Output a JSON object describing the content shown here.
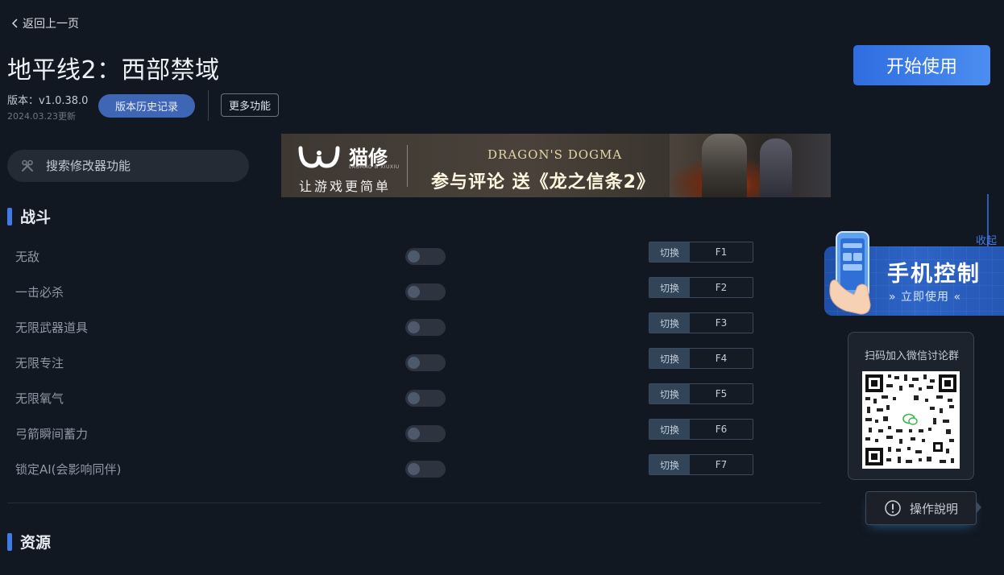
{
  "nav": {
    "back_label": "返回上一页"
  },
  "header": {
    "title": "地平线2：西部禁域",
    "version": "版本：v1.0.38.0",
    "updated": "2024.03.23更新",
    "history_button": "版本历史记录",
    "more_button": "更多功能",
    "start_button": "开始使用"
  },
  "search": {
    "placeholder": "搜索修改器功能"
  },
  "banner": {
    "brand": "猫修",
    "brand_sub": "LAOMAO & XIUXIU",
    "slogan": "让游戏更简单",
    "game": "DRAGON'S DOGMA",
    "promo": "参与评论 送《龙之信条2》"
  },
  "sections": [
    {
      "title": "战斗",
      "items": [
        {
          "label": "无敌",
          "switch_label": "切换",
          "key": "F1",
          "enabled": false
        },
        {
          "label": "一击必杀",
          "switch_label": "切换",
          "key": "F2",
          "enabled": false
        },
        {
          "label": "无限武器道具",
          "switch_label": "切换",
          "key": "F3",
          "enabled": false
        },
        {
          "label": "无限专注",
          "switch_label": "切换",
          "key": "F4",
          "enabled": false
        },
        {
          "label": "无限氧气",
          "switch_label": "切换",
          "key": "F5",
          "enabled": false
        },
        {
          "label": "弓箭瞬间蓄力",
          "switch_label": "切换",
          "key": "F6",
          "enabled": false
        },
        {
          "label": "锁定AI(会影响同伴)",
          "switch_label": "切换",
          "key": "F7",
          "enabled": false
        }
      ]
    },
    {
      "title": "资源"
    }
  ],
  "side_panel": {
    "collapse_label": "收起",
    "phone_title": "手机控制",
    "phone_action": "立即使用",
    "qr_title": "扫码加入微信讨论群",
    "help_label": "操作說明"
  },
  "colors": {
    "accent": "#3f7be8",
    "background": "#121821",
    "start_button": "#3a7ee8"
  }
}
